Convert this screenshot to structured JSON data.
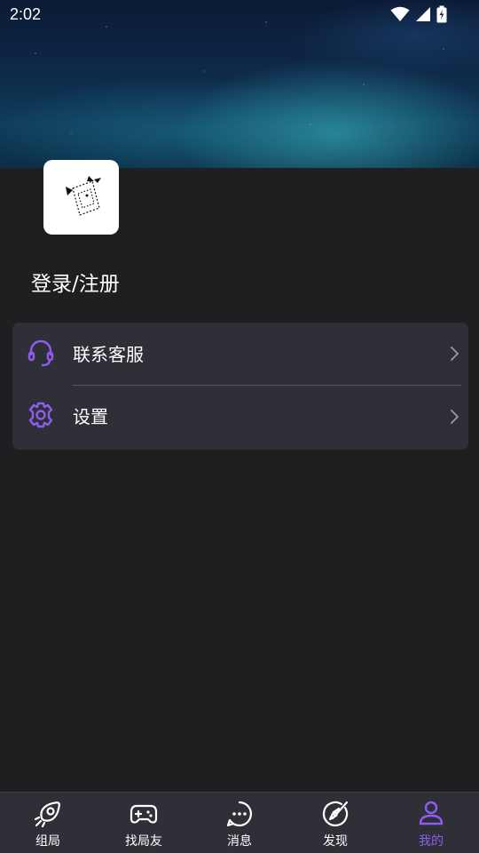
{
  "status_bar": {
    "time": "2:02",
    "icons": [
      "wifi-icon",
      "cell-signal-icon",
      "battery-charging-icon"
    ]
  },
  "profile": {
    "avatar_icon": "avatar-logo-icon",
    "login_label": "登录/注册"
  },
  "menu": {
    "items": [
      {
        "label": "联系客服",
        "icon": "headset-icon"
      },
      {
        "label": "设置",
        "icon": "gear-icon"
      }
    ]
  },
  "bottom_nav": {
    "items": [
      {
        "label": "组局",
        "icon": "rocket-icon",
        "active": false
      },
      {
        "label": "找局友",
        "icon": "gamepad-icon",
        "active": false
      },
      {
        "label": "消息",
        "icon": "chat-bubble-icon",
        "active": false
      },
      {
        "label": "发现",
        "icon": "compass-icon",
        "active": false
      },
      {
        "label": "我的",
        "icon": "user-icon",
        "active": true
      }
    ]
  },
  "colors": {
    "background": "#1f1f21",
    "card": "#2f2f38",
    "accent": "#8e5cf0",
    "text": "#ffffff"
  }
}
